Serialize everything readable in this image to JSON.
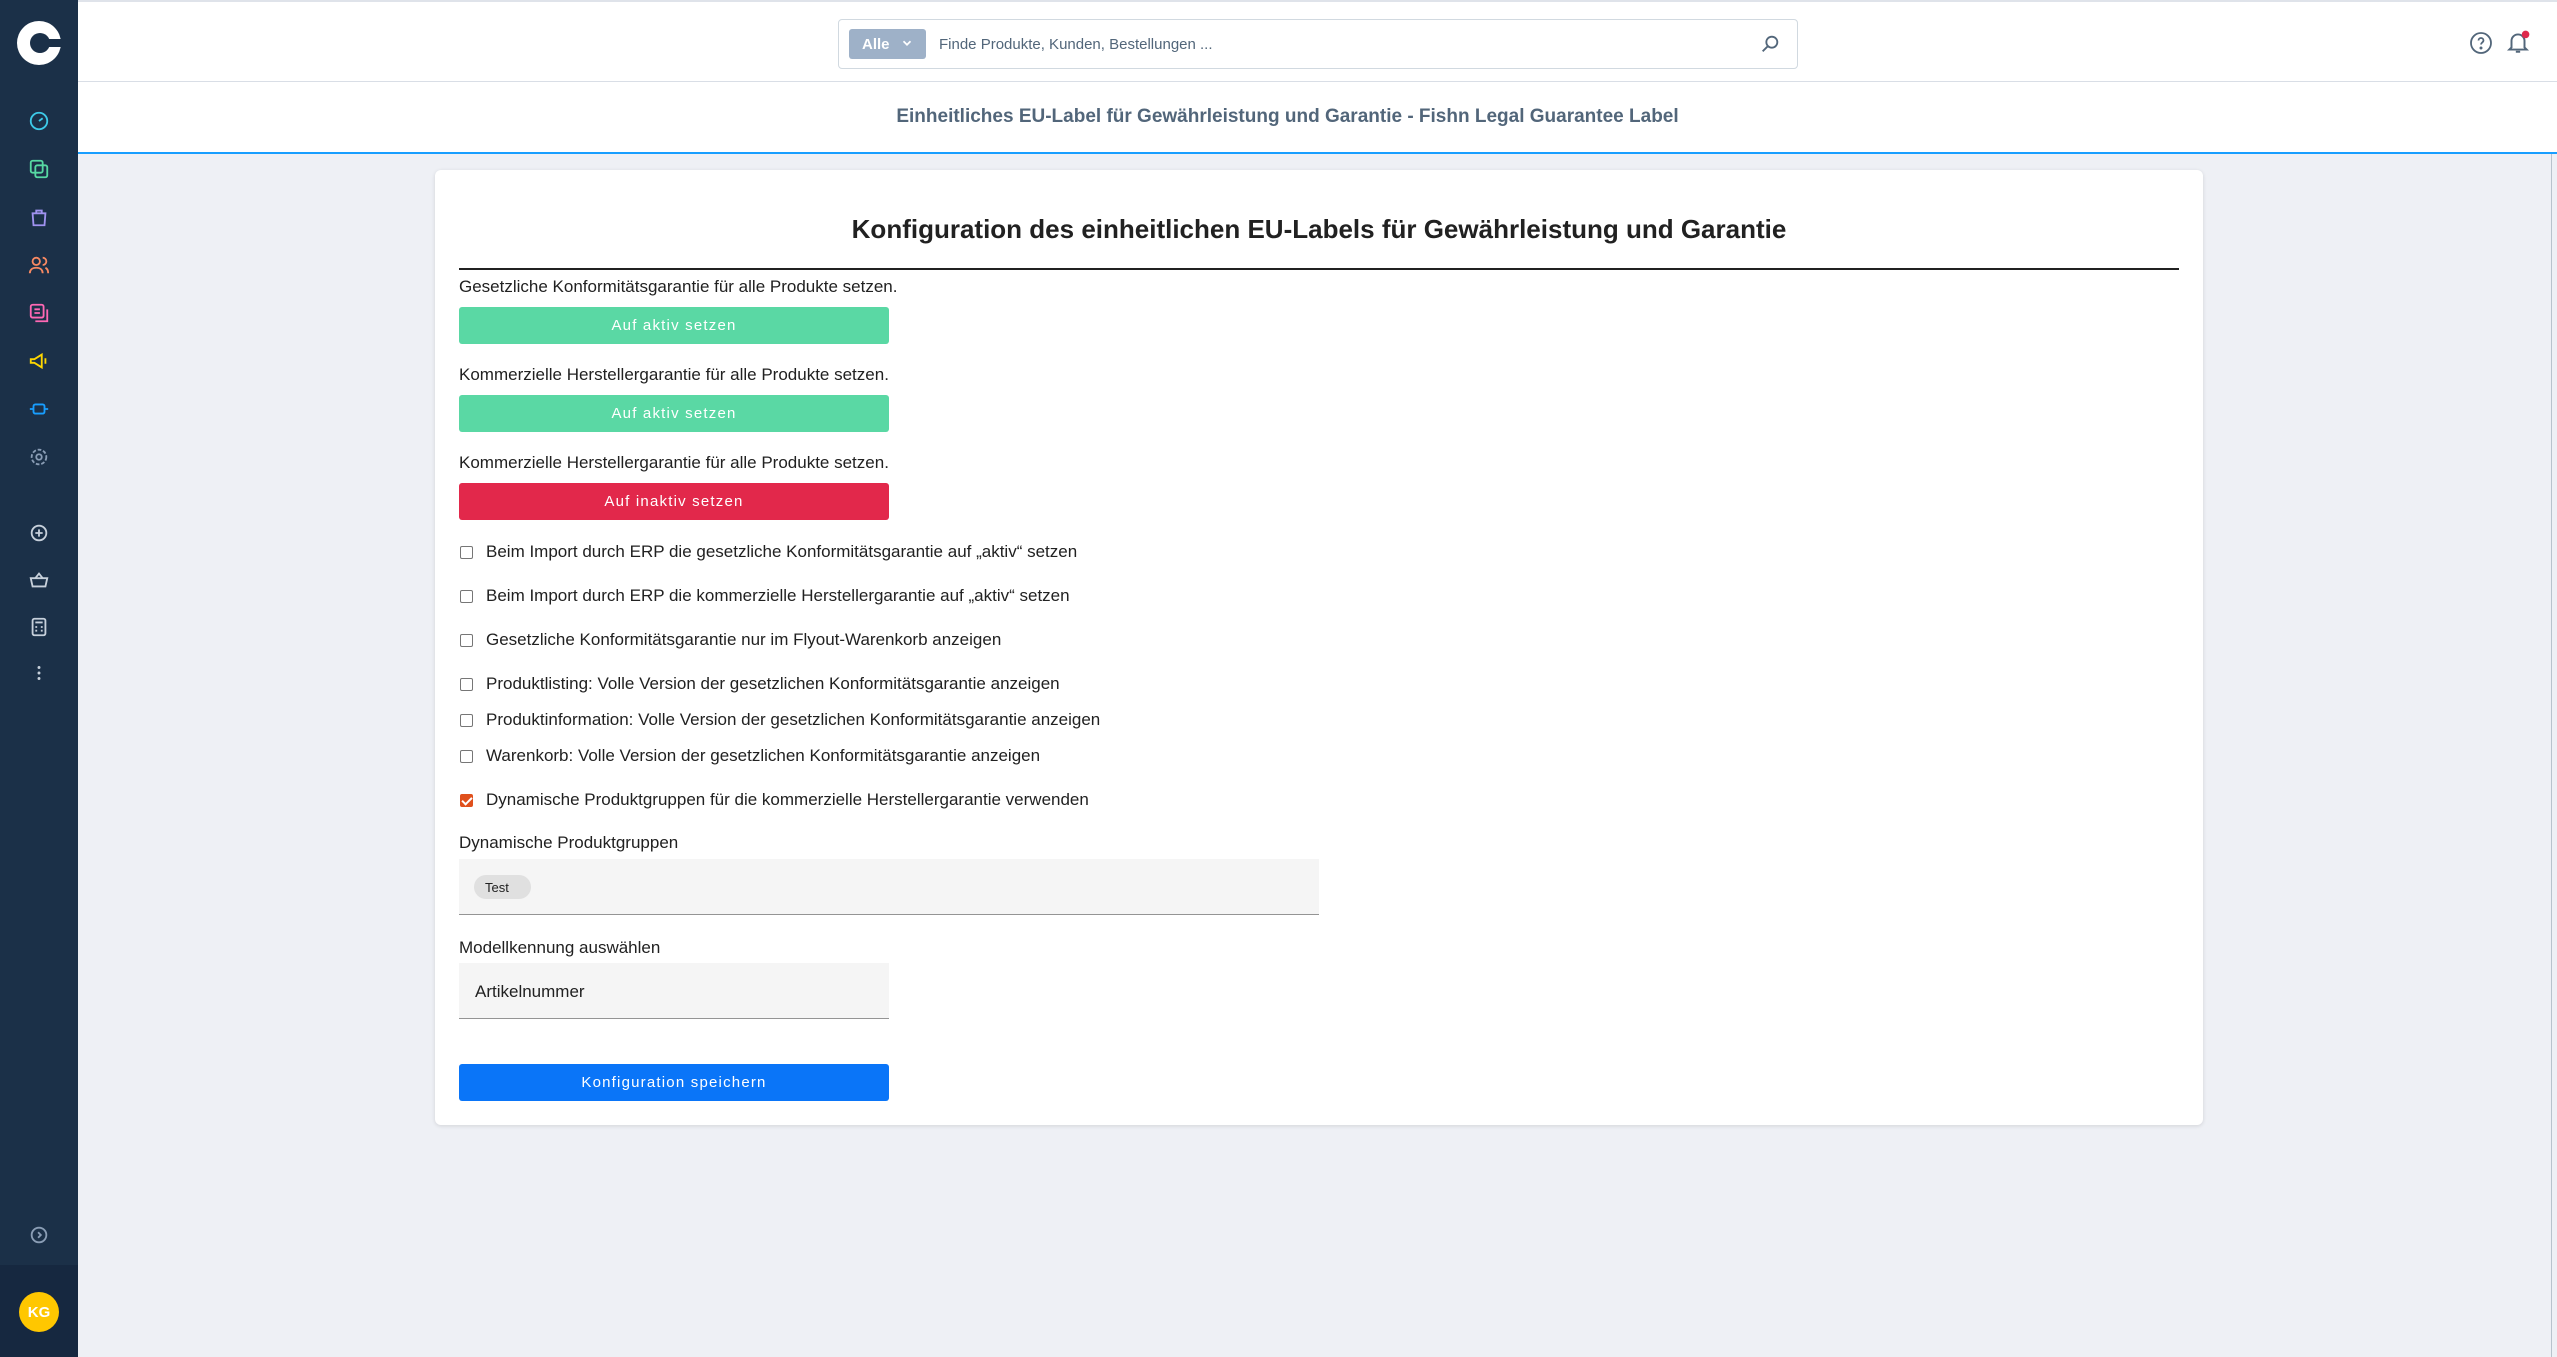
{
  "app": {
    "user_initials": "KG"
  },
  "search": {
    "type_label": "Alle",
    "placeholder": "Finde Produkte, Kunden, Bestellungen ..."
  },
  "page": {
    "title": "Einheitliches EU-Label für Gewährleistung und Garantie - Fishn Legal Guarantee Label"
  },
  "card": {
    "title": "Konfiguration des einheitlichen EU-Labels für Gewährleistung und Garantie",
    "sections": [
      {
        "label": "Gesetzliche Konformitätsgarantie für alle Produkte setzen.",
        "button": "Auf aktiv setzen"
      },
      {
        "label": "Kommerzielle Herstellergarantie für alle Produkte setzen.",
        "button": "Auf aktiv setzen"
      },
      {
        "label": "Kommerzielle Herstellergarantie für alle Produkte setzen.",
        "button": "Auf inaktiv setzen"
      }
    ],
    "checkboxes": [
      {
        "label": "Beim Import durch ERP die gesetzliche Konformitätsgarantie auf „aktiv“ setzen",
        "checked": false
      },
      {
        "label": "Beim Import durch ERP die kommerzielle Herstellergarantie auf „aktiv“ setzen",
        "checked": false
      },
      {
        "label": "Gesetzliche Konformitätsgarantie nur im Flyout-Warenkorb anzeigen",
        "checked": false
      },
      {
        "label": "Produktlisting: Volle Version der gesetzlichen Konformitätsgarantie anzeigen",
        "checked": false
      },
      {
        "label": "Produktinformation: Volle Version der gesetzlichen Konformitätsgarantie anzeigen",
        "checked": false
      },
      {
        "label": "Warenkorb: Volle Version der gesetzlichen Konformitätsgarantie anzeigen",
        "checked": false
      },
      {
        "label": "Dynamische Produktgruppen für die kommerzielle Herstellergarantie verwenden",
        "checked": true
      }
    ],
    "product_groups": {
      "label": "Dynamische Produktgruppen",
      "chips": [
        "Test"
      ]
    },
    "model_id": {
      "label": "Modellkennung auswählen",
      "value": "Artikelnummer"
    },
    "save_button": "Konfiguration speichern"
  },
  "colors": {
    "sidebar_bg": "#1b3048",
    "accent_blue": "#189eff",
    "button_green": "#5ad8a4",
    "button_red": "#e2284b",
    "button_blue": "#0a75f8",
    "checkbox_checked": "#e0501c",
    "avatar_bg": "#ffc700"
  },
  "icons": {
    "nav": [
      "dashboard-icon",
      "catalogue-icon",
      "orders-icon",
      "customers-icon",
      "content-icon",
      "marketing-icon",
      "extensions-icon",
      "settings-icon",
      "add-icon",
      "basket-icon",
      "calculator-icon",
      "more-icon"
    ]
  }
}
